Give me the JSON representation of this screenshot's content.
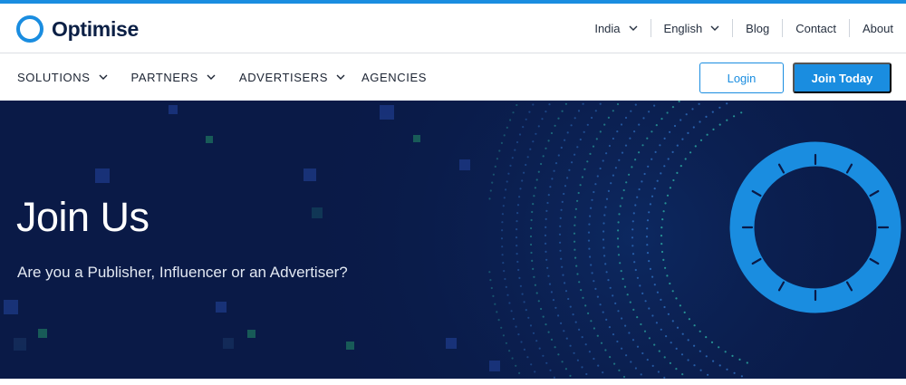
{
  "brand": {
    "name": "Optimise",
    "accent": "#1a8de0",
    "hero_bg": "#0a1a47"
  },
  "utility_nav": {
    "country": "India",
    "language": "English",
    "links": [
      "Blog",
      "Contact",
      "About"
    ]
  },
  "main_nav": {
    "items": [
      {
        "label": "SOLUTIONS",
        "dropdown": true
      },
      {
        "label": "PARTNERS",
        "dropdown": true
      },
      {
        "label": "ADVERTISERS",
        "dropdown": true
      },
      {
        "label": "AGENCIES",
        "dropdown": false
      }
    ],
    "login_label": "Login",
    "join_label": "Join Today"
  },
  "hero": {
    "title": "Join Us",
    "subtitle": "Are you a Publisher, Influencer or an Advertiser?"
  },
  "icons": [
    "logo-ring-icon",
    "chevron-down-icon"
  ]
}
